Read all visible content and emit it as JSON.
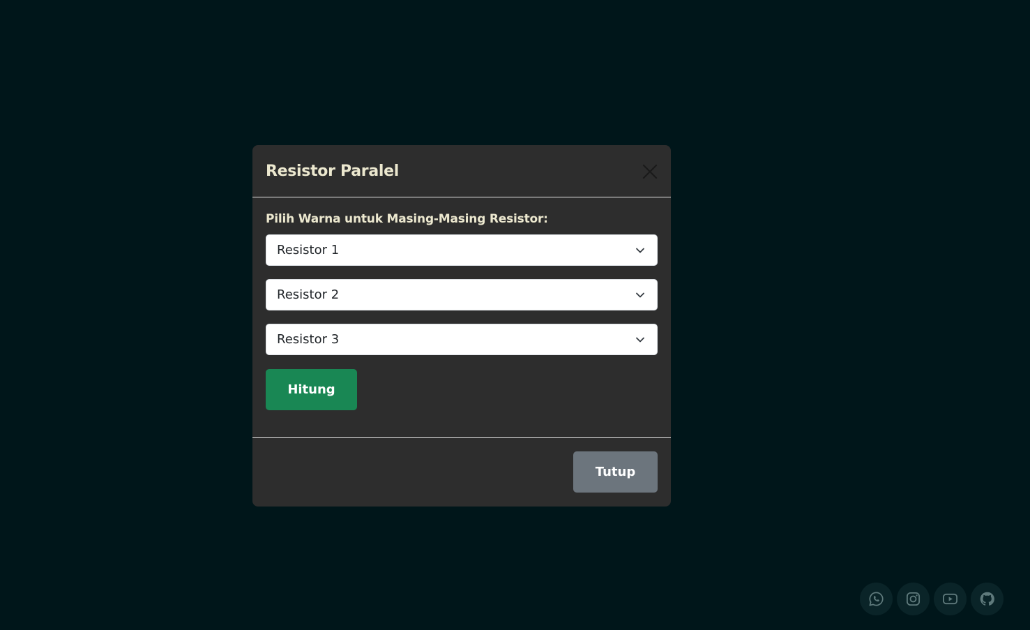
{
  "modal": {
    "title": "Resistor Paralel",
    "prompt": "Pilih Warna untuk Masing-Masing Resistor:",
    "selects": [
      {
        "value": "Resistor 1"
      },
      {
        "value": "Resistor 2"
      },
      {
        "value": "Resistor 3"
      }
    ],
    "calculate_label": "Hitung",
    "close_label": "Tutup"
  },
  "social": {
    "icons": [
      "whatsapp-icon",
      "instagram-icon",
      "youtube-icon",
      "github-icon"
    ]
  },
  "colors": {
    "background": "#00161a",
    "modal_bg": "#2d2d2d",
    "title_text": "#ece8cf",
    "success": "#198754",
    "secondary": "#6c757d",
    "social_bg": "#0a2428",
    "social_icon": "#5f7a7c"
  }
}
